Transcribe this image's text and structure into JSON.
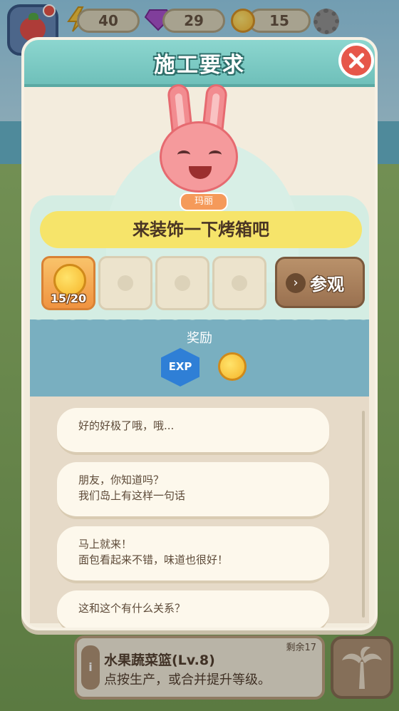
{
  "hud": {
    "energy": "40",
    "gems": "29",
    "coins": "15"
  },
  "dialog": {
    "title": "施工要求",
    "character_name": "玛丽",
    "task": "来装饰一下烤箱吧",
    "slots": [
      {
        "count": "15/20",
        "active": true
      },
      {
        "count": "",
        "active": false
      },
      {
        "count": "",
        "active": false
      },
      {
        "count": "",
        "active": false
      }
    ],
    "visit_label": "参观",
    "reward_title": "奖励",
    "exp_label": "EXP",
    "chat": [
      {
        "line1": "好的好极了哦，哦...",
        "line2": ""
      },
      {
        "line1": "朋友，你知道吗？",
        "line2": "我们岛上有这样一句话"
      },
      {
        "line1": "马上就来！",
        "line2": "面包看起来不错，味道也很好！"
      },
      {
        "line1": "这和这个有什么关系？",
        "line2": ""
      }
    ]
  },
  "info": {
    "remaining": "剩余17",
    "title": "水果蔬菜篮(Lv.8)",
    "subtitle": "点按生产，或合并提升等级。",
    "icon": "i"
  },
  "colors": {
    "header": "#7cc9c3",
    "task_bar": "#f6e46a",
    "close": "#e6574a"
  }
}
